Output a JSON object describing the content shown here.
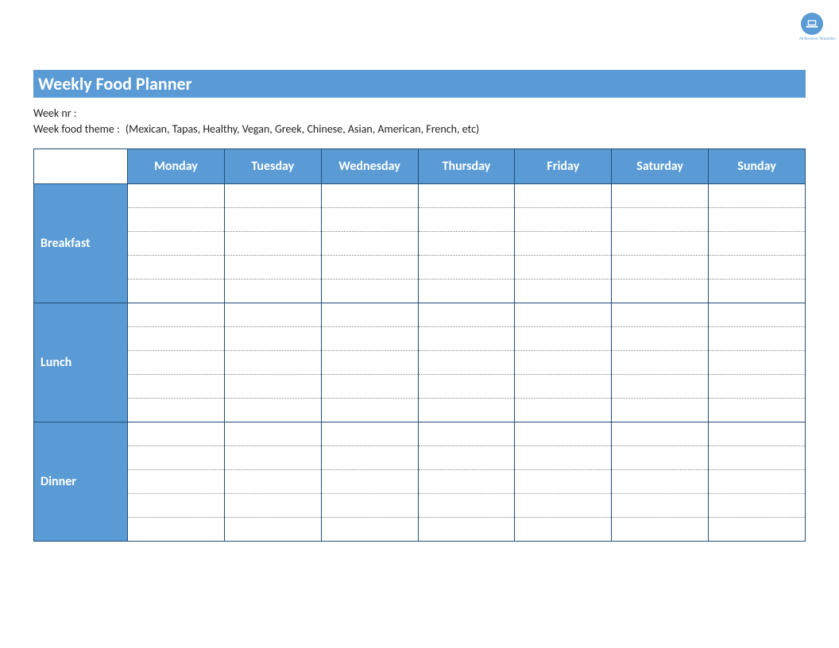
{
  "logo": {
    "text": "All Business Templates"
  },
  "header": {
    "title": "Weekly Food Planner"
  },
  "meta": {
    "week_nr_label": "Week nr :",
    "week_nr_value": "",
    "theme_label": "Week food theme :",
    "theme_value": "(Mexican, Tapas, Healthy, Vegan, Greek, Chinese, Asian, American, French, etc)"
  },
  "planner": {
    "days": [
      "Monday",
      "Tuesday",
      "Wednesday",
      "Thursday",
      "Friday",
      "Saturday",
      "Sunday"
    ],
    "meals": [
      "Breakfast",
      "Lunch",
      "Dinner"
    ],
    "lines_per_cell": 5,
    "grid": {
      "Breakfast": {
        "Monday": "",
        "Tuesday": "",
        "Wednesday": "",
        "Thursday": "",
        "Friday": "",
        "Saturday": "",
        "Sunday": ""
      },
      "Lunch": {
        "Monday": "",
        "Tuesday": "",
        "Wednesday": "",
        "Thursday": "",
        "Friday": "",
        "Saturday": "",
        "Sunday": ""
      },
      "Dinner": {
        "Monday": "",
        "Tuesday": "",
        "Wednesday": "",
        "Thursday": "",
        "Friday": "",
        "Saturday": "",
        "Sunday": ""
      }
    }
  },
  "colors": {
    "accent": "#5b9bd5",
    "border": "#1f4e79"
  }
}
